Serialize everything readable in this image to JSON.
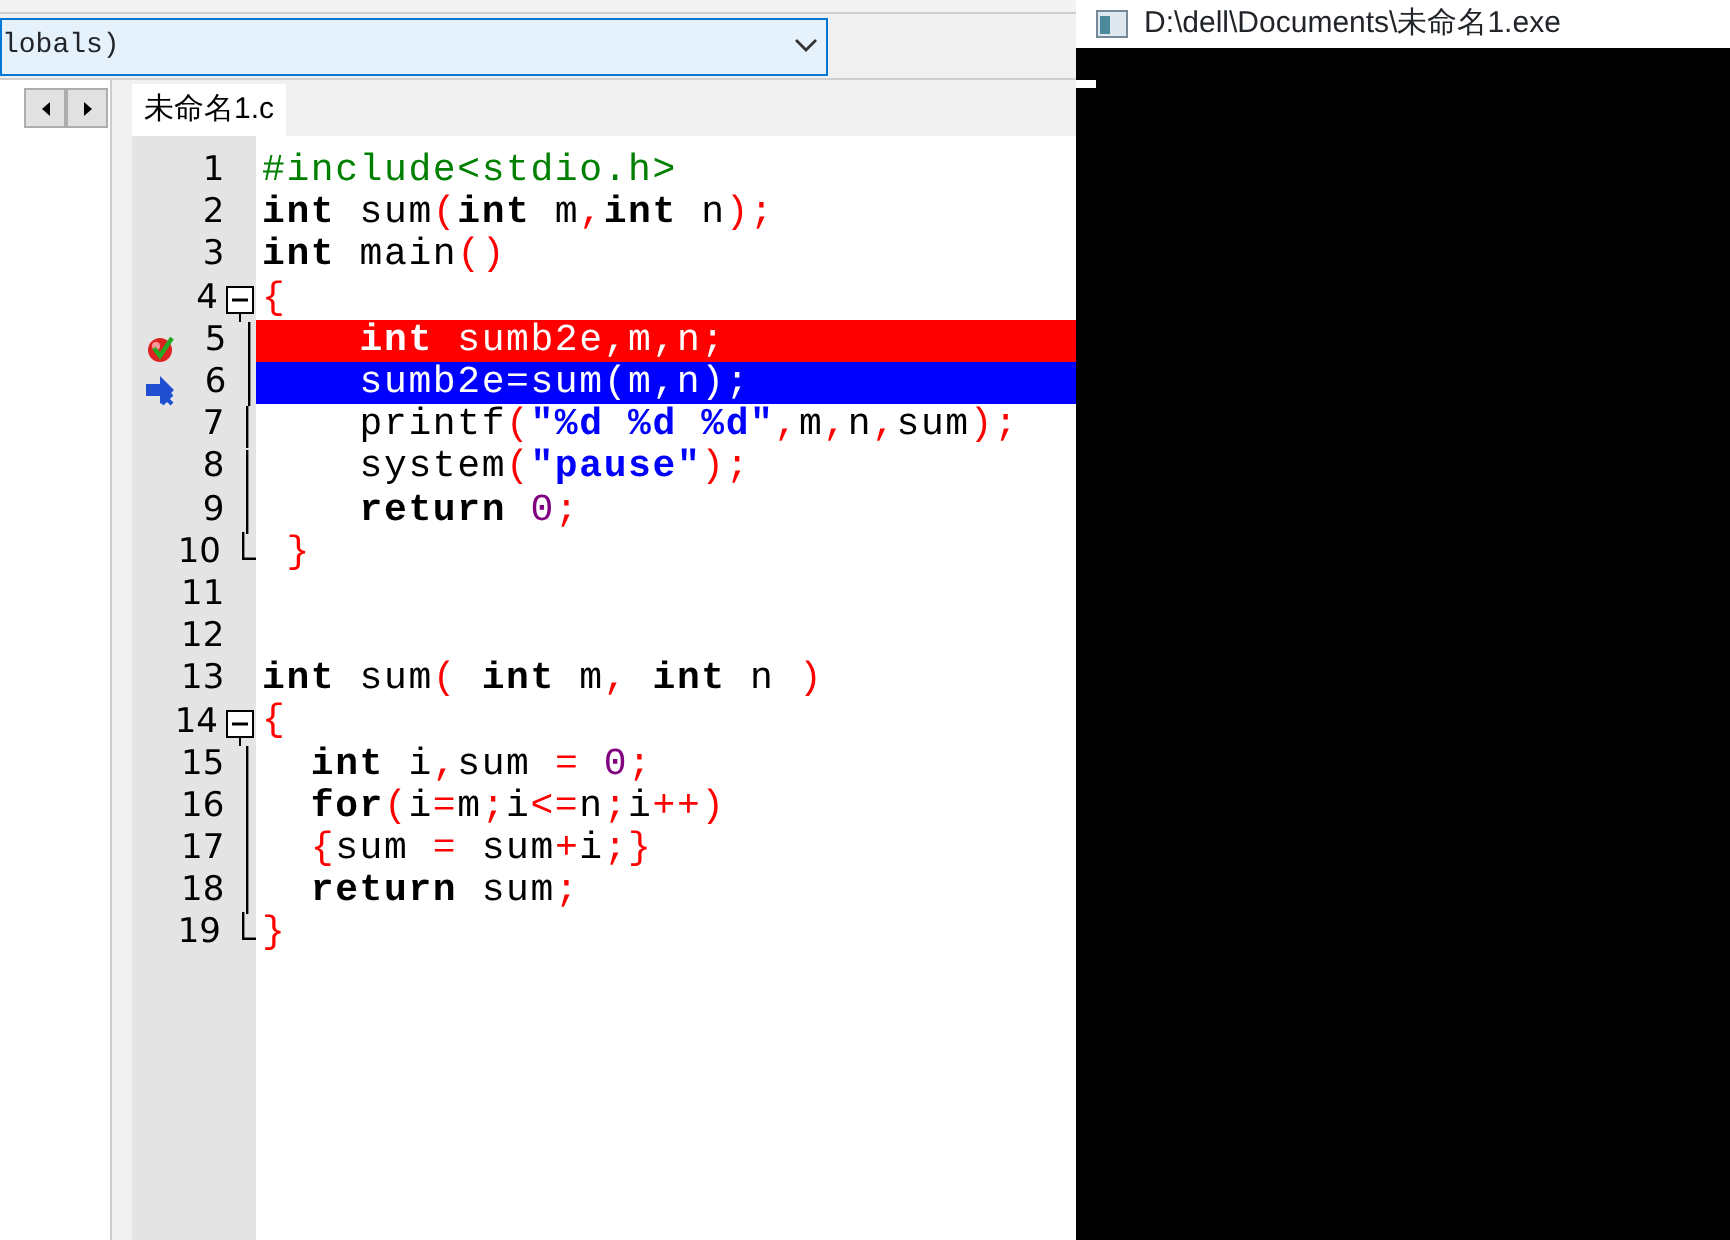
{
  "scope_combo": {
    "value": "lobals)"
  },
  "editor_tabs": [
    {
      "label": "未命名1.c",
      "selected": true
    }
  ],
  "code_lines": [
    {
      "number": "1",
      "breakpoint": false,
      "current": false,
      "segments": [
        {
          "kind": "pre",
          "text": "#include<stdio.h>"
        }
      ]
    },
    {
      "number": "2",
      "breakpoint": false,
      "current": false,
      "segments": [
        {
          "kind": "kw",
          "text": "int"
        },
        {
          "kind": "id",
          "text": " sum"
        },
        {
          "kind": "sym",
          "text": "("
        },
        {
          "kind": "kw",
          "text": "int"
        },
        {
          "kind": "id",
          "text": " m"
        },
        {
          "kind": "sym",
          "text": ","
        },
        {
          "kind": "kw",
          "text": "int"
        },
        {
          "kind": "id",
          "text": " n"
        },
        {
          "kind": "sym",
          "text": ");"
        }
      ]
    },
    {
      "number": "3",
      "breakpoint": false,
      "current": false,
      "segments": [
        {
          "kind": "kw",
          "text": "int"
        },
        {
          "kind": "id",
          "text": " main"
        },
        {
          "kind": "sym",
          "text": "()"
        }
      ]
    },
    {
      "number": "4",
      "breakpoint": false,
      "current": false,
      "expanded": true,
      "segments": [
        {
          "kind": "sym",
          "text": "{"
        }
      ],
      "children": [
        {
          "number": "5",
          "breakpoint": true,
          "current": false,
          "segments": [
            {
              "kind": "kw",
              "text": "    int"
            },
            {
              "kind": "id",
              "text": " sumb2e,m,n;"
            }
          ]
        },
        {
          "number": "6",
          "breakpoint": false,
          "current": true,
          "segments": [
            {
              "kind": "id",
              "text": "    sumb2e=sum(m,n);"
            }
          ]
        },
        {
          "number": "7",
          "breakpoint": false,
          "current": false,
          "segments": [
            {
              "kind": "id",
              "text": "    printf"
            },
            {
              "kind": "sym",
              "text": "("
            },
            {
              "kind": "str",
              "text": "\"%d %d %d\""
            },
            {
              "kind": "sym",
              "text": ","
            },
            {
              "kind": "id",
              "text": "m"
            },
            {
              "kind": "sym",
              "text": ","
            },
            {
              "kind": "id",
              "text": "n"
            },
            {
              "kind": "sym",
              "text": ","
            },
            {
              "kind": "id",
              "text": "sum"
            },
            {
              "kind": "sym",
              "text": ");"
            }
          ]
        },
        {
          "number": "8",
          "breakpoint": false,
          "current": false,
          "segments": [
            {
              "kind": "id",
              "text": "    system"
            },
            {
              "kind": "sym",
              "text": "("
            },
            {
              "kind": "str",
              "text": "\"pause\""
            },
            {
              "kind": "sym",
              "text": ");"
            }
          ]
        },
        {
          "number": "9",
          "breakpoint": false,
          "current": false,
          "segments": [
            {
              "kind": "kw",
              "text": "    return"
            },
            {
              "kind": "num",
              "text": " 0"
            },
            {
              "kind": "sym",
              "text": ";"
            }
          ]
        },
        {
          "number": "10",
          "breakpoint": false,
          "current": false,
          "segments": [
            {
              "kind": "sym",
              "text": " }"
            }
          ]
        }
      ]
    },
    {
      "number": "11",
      "breakpoint": false,
      "current": false
    },
    {
      "number": "12",
      "breakpoint": false,
      "current": false
    },
    {
      "number": "13",
      "breakpoint": false,
      "current": false,
      "segments": [
        {
          "kind": "kw",
          "text": "int"
        },
        {
          "kind": "id",
          "text": " sum"
        },
        {
          "kind": "sym",
          "text": "( "
        },
        {
          "kind": "kw",
          "text": "int"
        },
        {
          "kind": "id",
          "text": " m"
        },
        {
          "kind": "sym",
          "text": ", "
        },
        {
          "kind": "kw",
          "text": "int"
        },
        {
          "kind": "id",
          "text": " n "
        },
        {
          "kind": "sym",
          "text": ")"
        }
      ]
    },
    {
      "number": "14",
      "breakpoint": false,
      "current": false,
      "expanded": true,
      "segments": [
        {
          "kind": "sym",
          "text": "{"
        }
      ],
      "children": [
        {
          "number": "15",
          "breakpoint": false,
          "current": false,
          "segments": [
            {
              "kind": "kw",
              "text": "  int"
            },
            {
              "kind": "id",
              "text": " i"
            },
            {
              "kind": "sym",
              "text": ","
            },
            {
              "kind": "id",
              "text": "sum "
            },
            {
              "kind": "sym",
              "text": "="
            },
            {
              "kind": "num",
              "text": " 0"
            },
            {
              "kind": "sym",
              "text": ";"
            }
          ]
        },
        {
          "number": "16",
          "breakpoint": false,
          "current": false,
          "segments": [
            {
              "kind": "kw",
              "text": "  for"
            },
            {
              "kind": "sym",
              "text": "("
            },
            {
              "kind": "id",
              "text": "i"
            },
            {
              "kind": "sym",
              "text": "="
            },
            {
              "kind": "id",
              "text": "m"
            },
            {
              "kind": "sym",
              "text": ";"
            },
            {
              "kind": "id",
              "text": "i"
            },
            {
              "kind": "sym",
              "text": "<="
            },
            {
              "kind": "id",
              "text": "n"
            },
            {
              "kind": "sym",
              "text": ";"
            },
            {
              "kind": "id",
              "text": "i"
            },
            {
              "kind": "sym",
              "text": "++)"
            }
          ]
        },
        {
          "number": "17",
          "breakpoint": false,
          "current": false,
          "segments": [
            {
              "kind": "sym",
              "text": "  {"
            },
            {
              "kind": "id",
              "text": "sum "
            },
            {
              "kind": "sym",
              "text": "="
            },
            {
              "kind": "id",
              "text": " sum"
            },
            {
              "kind": "sym",
              "text": "+"
            },
            {
              "kind": "id",
              "text": "i"
            },
            {
              "kind": "sym",
              "text": ";}"
            }
          ]
        },
        {
          "number": "18",
          "breakpoint": false,
          "current": false,
          "segments": [
            {
              "kind": "kw",
              "text": "  return"
            },
            {
              "kind": "id",
              "text": " sum"
            },
            {
              "kind": "sym",
              "text": ";"
            }
          ]
        },
        {
          "number": "19",
          "breakpoint": false,
          "current": false,
          "segments": [
            {
              "kind": "sym",
              "text": "}"
            }
          ]
        }
      ]
    }
  ],
  "console": {
    "title": "D:\\dell\\Documents\\未命名1.exe"
  }
}
